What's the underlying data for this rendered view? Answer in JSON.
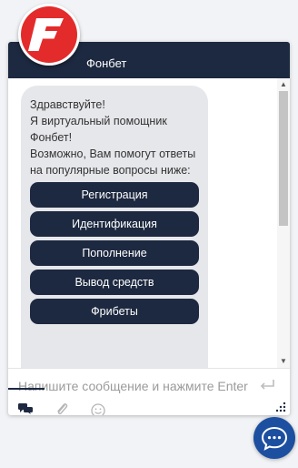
{
  "header": {
    "title": "Фонбет",
    "logo_icon": "fonbet-logo-icon",
    "background": "#1d2940",
    "logo_color": "#e32b2b"
  },
  "chat": {
    "greeting": "Здравствуйте!\nЯ виртуальный помощник Фонбет!\nВозможно, Вам помогут ответы на популярные вопросы ниже:",
    "quick_replies": [
      "Регистрация",
      "Идентификация",
      "Пополнение",
      "Вывод средств",
      "Фрибеты"
    ]
  },
  "input": {
    "placeholder": "Напишите сообщение и нажмите Enter",
    "value": ""
  },
  "toolbar": {
    "icons": [
      "chat-bubbles-icon",
      "paperclip-icon",
      "smiley-icon"
    ]
  },
  "colors": {
    "accent": "#1d2940",
    "fab": "#1d4fa0",
    "bubble": "#e6e7eb"
  }
}
